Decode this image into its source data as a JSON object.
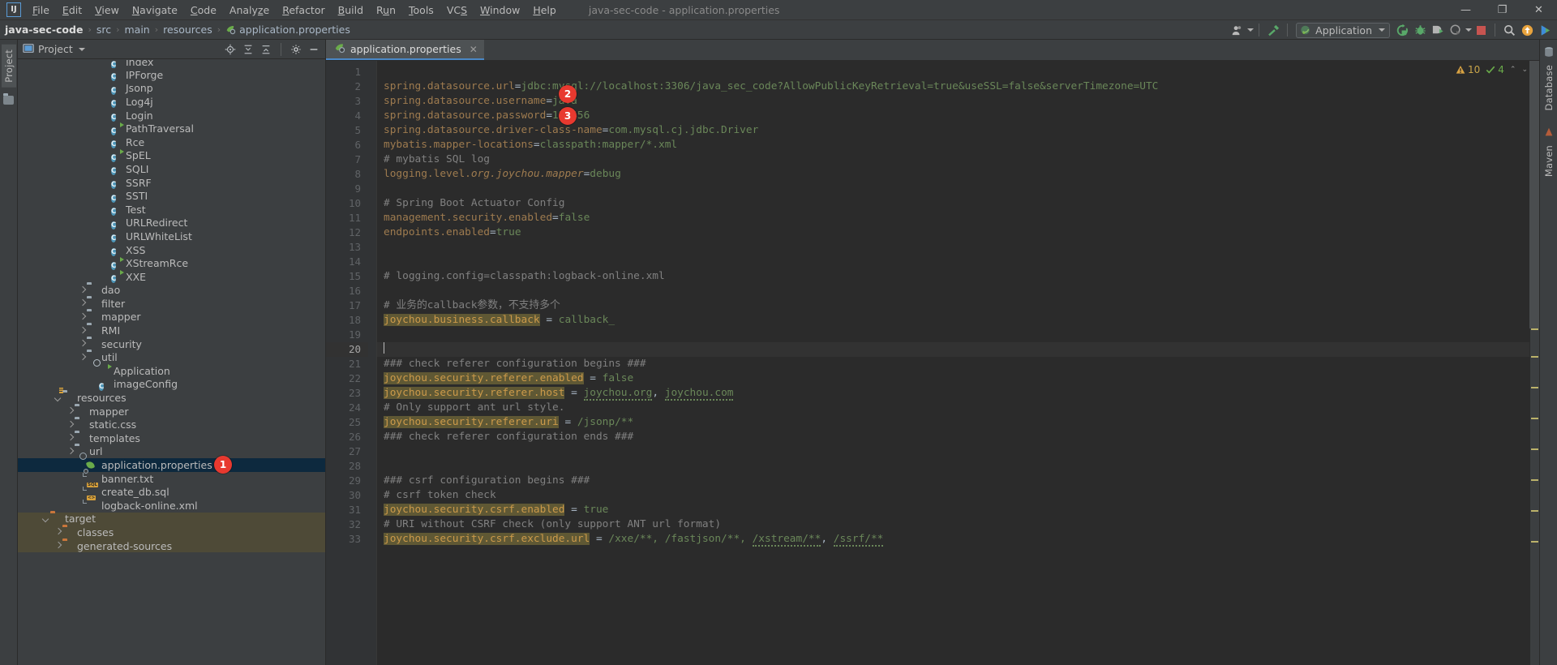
{
  "window": {
    "title": "java-sec-code - application.properties",
    "minimize": "—",
    "maximize": "❐",
    "close": "✕"
  },
  "menu": {
    "items": [
      {
        "label": "File",
        "mnemonic": "F"
      },
      {
        "label": "Edit",
        "mnemonic": "E"
      },
      {
        "label": "View",
        "mnemonic": "V"
      },
      {
        "label": "Navigate",
        "mnemonic": "N"
      },
      {
        "label": "Code",
        "mnemonic": "C"
      },
      {
        "label": "Analyze",
        "mnemonic": "z"
      },
      {
        "label": "Refactor",
        "mnemonic": "R"
      },
      {
        "label": "Build",
        "mnemonic": "B"
      },
      {
        "label": "Run",
        "mnemonic": "u"
      },
      {
        "label": "Tools",
        "mnemonic": "T"
      },
      {
        "label": "VCS",
        "mnemonic": "S"
      },
      {
        "label": "Window",
        "mnemonic": "W"
      },
      {
        "label": "Help",
        "mnemonic": "H"
      }
    ],
    "logo": "IJ"
  },
  "breadcrumb": {
    "items": [
      "java-sec-code",
      "src",
      "main",
      "resources",
      "application.properties"
    ],
    "separator": "›"
  },
  "toolbar": {
    "avatar_label": "user-settings",
    "updates_label": "hammer-build",
    "run_config": "Application",
    "buttons": [
      {
        "name": "rerun-icon",
        "label": "↻"
      },
      {
        "name": "debug-icon",
        "label": "debug"
      },
      {
        "name": "run-with-coverage-icon",
        "label": "coverage"
      },
      {
        "name": "profiler-icon",
        "label": "profile"
      },
      {
        "name": "stop-icon",
        "label": "stop"
      },
      {
        "name": "search-everywhere-icon",
        "label": "search"
      },
      {
        "name": "update-project-icon",
        "label": "update"
      },
      {
        "name": "run-anything-icon",
        "label": "run"
      }
    ]
  },
  "leftstrip": {
    "project_tab": "Project",
    "structure_icon": "folder-icon"
  },
  "rightstrip": {
    "database_tab": "Database",
    "maven_tab": "Maven"
  },
  "project_panel": {
    "title": "Project",
    "head_buttons": [
      {
        "name": "locate-icon",
        "label": "locate"
      },
      {
        "name": "expand-all-icon",
        "label": "expand"
      },
      {
        "name": "collapse-all-icon",
        "label": "collapse"
      },
      {
        "name": "settings-gear-icon",
        "label": "gear"
      },
      {
        "name": "hide-panel-icon",
        "label": "—"
      }
    ],
    "tree": [
      {
        "label": "Index",
        "icon": "class",
        "run": false,
        "indent": 7,
        "arrow": "none",
        "partial": true
      },
      {
        "label": "IPForge",
        "icon": "class",
        "run": false,
        "indent": 7,
        "arrow": "none"
      },
      {
        "label": "Jsonp",
        "icon": "class",
        "run": false,
        "indent": 7,
        "arrow": "none"
      },
      {
        "label": "Log4j",
        "icon": "class",
        "run": false,
        "indent": 7,
        "arrow": "none"
      },
      {
        "label": "Login",
        "icon": "class",
        "run": false,
        "indent": 7,
        "arrow": "none"
      },
      {
        "label": "PathTraversal",
        "icon": "class",
        "run": true,
        "indent": 7,
        "arrow": "none"
      },
      {
        "label": "Rce",
        "icon": "class",
        "run": false,
        "indent": 7,
        "arrow": "none"
      },
      {
        "label": "SpEL",
        "icon": "class",
        "run": true,
        "indent": 7,
        "arrow": "none"
      },
      {
        "label": "SQLI",
        "icon": "class",
        "run": false,
        "indent": 7,
        "arrow": "none"
      },
      {
        "label": "SSRF",
        "icon": "class",
        "run": false,
        "indent": 7,
        "arrow": "none"
      },
      {
        "label": "SSTI",
        "icon": "class",
        "run": false,
        "indent": 7,
        "arrow": "none"
      },
      {
        "label": "Test",
        "icon": "class",
        "run": false,
        "indent": 7,
        "arrow": "none"
      },
      {
        "label": "URLRedirect",
        "icon": "class",
        "run": false,
        "indent": 7,
        "arrow": "none"
      },
      {
        "label": "URLWhiteList",
        "icon": "class",
        "run": false,
        "indent": 7,
        "arrow": "none"
      },
      {
        "label": "XSS",
        "icon": "class",
        "run": false,
        "indent": 7,
        "arrow": "none"
      },
      {
        "label": "XStreamRce",
        "icon": "class",
        "run": true,
        "indent": 7,
        "arrow": "none"
      },
      {
        "label": "XXE",
        "icon": "class",
        "run": true,
        "indent": 7,
        "arrow": "none"
      },
      {
        "label": "dao",
        "icon": "folder",
        "indent": 5,
        "arrow": "closed"
      },
      {
        "label": "filter",
        "icon": "folder",
        "indent": 5,
        "arrow": "closed"
      },
      {
        "label": "mapper",
        "icon": "folder",
        "indent": 5,
        "arrow": "closed"
      },
      {
        "label": "RMI",
        "icon": "folder",
        "indent": 5,
        "arrow": "closed"
      },
      {
        "label": "security",
        "icon": "folder",
        "indent": 5,
        "arrow": "closed"
      },
      {
        "label": "util",
        "icon": "folder",
        "indent": 5,
        "arrow": "closed"
      },
      {
        "label": "Application",
        "icon": "app",
        "indent": 6,
        "arrow": "none"
      },
      {
        "label": "imageConfig",
        "icon": "class",
        "run": false,
        "indent": 6,
        "arrow": "none"
      },
      {
        "label": "resources",
        "icon": "srcfolder",
        "indent": 3,
        "arrow": "open"
      },
      {
        "label": "mapper",
        "icon": "folder-plain",
        "indent": 4,
        "arrow": "closed"
      },
      {
        "label": "static.css",
        "icon": "folder-plain",
        "indent": 4,
        "arrow": "closed"
      },
      {
        "label": "templates",
        "icon": "folder-plain",
        "indent": 4,
        "arrow": "closed"
      },
      {
        "label": "url",
        "icon": "folder-plain",
        "indent": 4,
        "arrow": "closed"
      },
      {
        "label": "application.properties",
        "icon": "props",
        "indent": 5,
        "arrow": "none",
        "selected": true,
        "bubble": "1"
      },
      {
        "label": "banner.txt",
        "icon": "file-txt",
        "indent": 5,
        "arrow": "none"
      },
      {
        "label": "create_db.sql",
        "icon": "file-sql",
        "indent": 5,
        "arrow": "none"
      },
      {
        "label": "logback-online.xml",
        "icon": "file-xml",
        "indent": 5,
        "arrow": "none"
      },
      {
        "label": "target",
        "icon": "folder-orange",
        "indent": 2,
        "arrow": "open",
        "tint": true
      },
      {
        "label": "classes",
        "icon": "folder-orange",
        "indent": 3,
        "arrow": "closed",
        "tint": true
      },
      {
        "label": "generated-sources",
        "icon": "folder-orange",
        "indent": 3,
        "arrow": "closed",
        "tint": true
      }
    ]
  },
  "editor": {
    "tab": {
      "label": "application.properties",
      "close": "✕"
    },
    "inspections": {
      "warnings": "10",
      "warn_icon": "⚠",
      "oks": "4",
      "ok_icon": "✓",
      "up": "⌃",
      "down": "⌄"
    },
    "current_line": 20,
    "lines": [
      {
        "n": 1,
        "tokens": []
      },
      {
        "n": 2,
        "tokens": [
          {
            "t": "spring.datasource.url",
            "c": "k"
          },
          {
            "t": "=",
            "c": "eq"
          },
          {
            "t": "jdbc:mysql://localhost:3306/java_sec_code?AllowPublicKeyRetrieval=true&useSSL=false&serverTimezone=UTC",
            "c": "val"
          }
        ]
      },
      {
        "n": 3,
        "tokens": [
          {
            "t": "spring.datasource.username",
            "c": "k"
          },
          {
            "t": "=",
            "c": "eq"
          },
          {
            "t": "java",
            "c": "val"
          }
        ],
        "bubble": "2"
      },
      {
        "n": 4,
        "tokens": [
          {
            "t": "spring.datasource.password",
            "c": "k"
          },
          {
            "t": "=",
            "c": "eq"
          },
          {
            "t": "123456",
            "c": "val"
          }
        ],
        "bubble": "3"
      },
      {
        "n": 5,
        "tokens": [
          {
            "t": "spring.datasource.driver-class-name",
            "c": "k"
          },
          {
            "t": "=",
            "c": "eq"
          },
          {
            "t": "com.mysql.cj.jdbc.Driver",
            "c": "val"
          }
        ]
      },
      {
        "n": 6,
        "tokens": [
          {
            "t": "mybatis.mapper-locations",
            "c": "k"
          },
          {
            "t": "=",
            "c": "eq"
          },
          {
            "t": "classpath:mapper/*.xml",
            "c": "val"
          }
        ]
      },
      {
        "n": 7,
        "tokens": [
          {
            "t": "# mybatis SQL log",
            "c": "cmt"
          }
        ]
      },
      {
        "n": 8,
        "tokens": [
          {
            "t": "logging.level.",
            "c": "k"
          },
          {
            "t": "org.joychou.mapper",
            "c": "ki"
          },
          {
            "t": "=",
            "c": "eq"
          },
          {
            "t": "debug",
            "c": "val"
          }
        ]
      },
      {
        "n": 9,
        "tokens": []
      },
      {
        "n": 10,
        "tokens": [
          {
            "t": "# Spring Boot Actuator Config",
            "c": "cmt"
          }
        ]
      },
      {
        "n": 11,
        "tokens": [
          {
            "t": "management.security.enabled",
            "c": "k"
          },
          {
            "t": "=",
            "c": "eq"
          },
          {
            "t": "false",
            "c": "val"
          }
        ]
      },
      {
        "n": 12,
        "tokens": [
          {
            "t": "endpoints.enabled",
            "c": "k"
          },
          {
            "t": "=",
            "c": "eq"
          },
          {
            "t": "true",
            "c": "val"
          }
        ]
      },
      {
        "n": 13,
        "tokens": []
      },
      {
        "n": 14,
        "tokens": []
      },
      {
        "n": 15,
        "tokens": [
          {
            "t": "# logging.config=classpath:logback-online.xml",
            "c": "cmt"
          }
        ]
      },
      {
        "n": 16,
        "tokens": []
      },
      {
        "n": 17,
        "tokens": [
          {
            "t": "# 业务的callback参数，不支持多个",
            "c": "cmt"
          }
        ]
      },
      {
        "n": 18,
        "tokens": [
          {
            "t": "joychou.business.callback",
            "c": "hl"
          },
          {
            "t": " = ",
            "c": "eq"
          },
          {
            "t": "callback_",
            "c": "val"
          }
        ]
      },
      {
        "n": 19,
        "tokens": []
      },
      {
        "n": 20,
        "tokens": [],
        "caret": true
      },
      {
        "n": 21,
        "tokens": [
          {
            "t": "### check referer configuration begins ###",
            "c": "cmt"
          }
        ]
      },
      {
        "n": 22,
        "tokens": [
          {
            "t": "joychou.security.referer.enabled",
            "c": "hl"
          },
          {
            "t": " = ",
            "c": "eq"
          },
          {
            "t": "false",
            "c": "val"
          }
        ]
      },
      {
        "n": 23,
        "tokens": [
          {
            "t": "joychou.security.referer.host",
            "c": "hl"
          },
          {
            "t": " = ",
            "c": "eq"
          },
          {
            "t": "joychou.org",
            "c": "valw"
          },
          {
            "t": ", ",
            "c": "eq"
          },
          {
            "t": "joychou.com",
            "c": "valw"
          }
        ]
      },
      {
        "n": 24,
        "tokens": [
          {
            "t": "# Only support ant url style.",
            "c": "cmt"
          }
        ]
      },
      {
        "n": 25,
        "tokens": [
          {
            "t": "joychou.security.referer.uri",
            "c": "hl"
          },
          {
            "t": " = ",
            "c": "eq"
          },
          {
            "t": "/jsonp/**",
            "c": "val"
          }
        ]
      },
      {
        "n": 26,
        "tokens": [
          {
            "t": "### check referer configuration ends ###",
            "c": "cmt"
          }
        ]
      },
      {
        "n": 27,
        "tokens": []
      },
      {
        "n": 28,
        "tokens": []
      },
      {
        "n": 29,
        "tokens": [
          {
            "t": "### csrf configuration begins ###",
            "c": "cmt"
          }
        ]
      },
      {
        "n": 30,
        "tokens": [
          {
            "t": "# csrf token check",
            "c": "cmt"
          }
        ]
      },
      {
        "n": 31,
        "tokens": [
          {
            "t": "joychou.security.csrf.enabled",
            "c": "hl"
          },
          {
            "t": " = ",
            "c": "eq"
          },
          {
            "t": "true",
            "c": "val"
          }
        ]
      },
      {
        "n": 32,
        "tokens": [
          {
            "t": "# URI without CSRF check (only support ANT url format)",
            "c": "cmt"
          }
        ]
      },
      {
        "n": 33,
        "tokens": [
          {
            "t": "joychou.security.csrf.exclude.url",
            "c": "hl"
          },
          {
            "t": " = ",
            "c": "eq"
          },
          {
            "t": "/xxe/**, /fastjson/**, ",
            "c": "val"
          },
          {
            "t": "/xstream/**",
            "c": "valw"
          },
          {
            "t": ", ",
            "c": "eq"
          },
          {
            "t": "/ssrf/**",
            "c": "valw"
          }
        ]
      }
    ]
  },
  "colors": {
    "accent": "#4a88c7",
    "bubble": "#e8392f",
    "selection": "#0d293e",
    "comment": "#808080",
    "value": "#6a8759",
    "key": "#9e7b4f",
    "key_highlight_bg": "#5f5834",
    "target_tint": "#4e4a37"
  }
}
